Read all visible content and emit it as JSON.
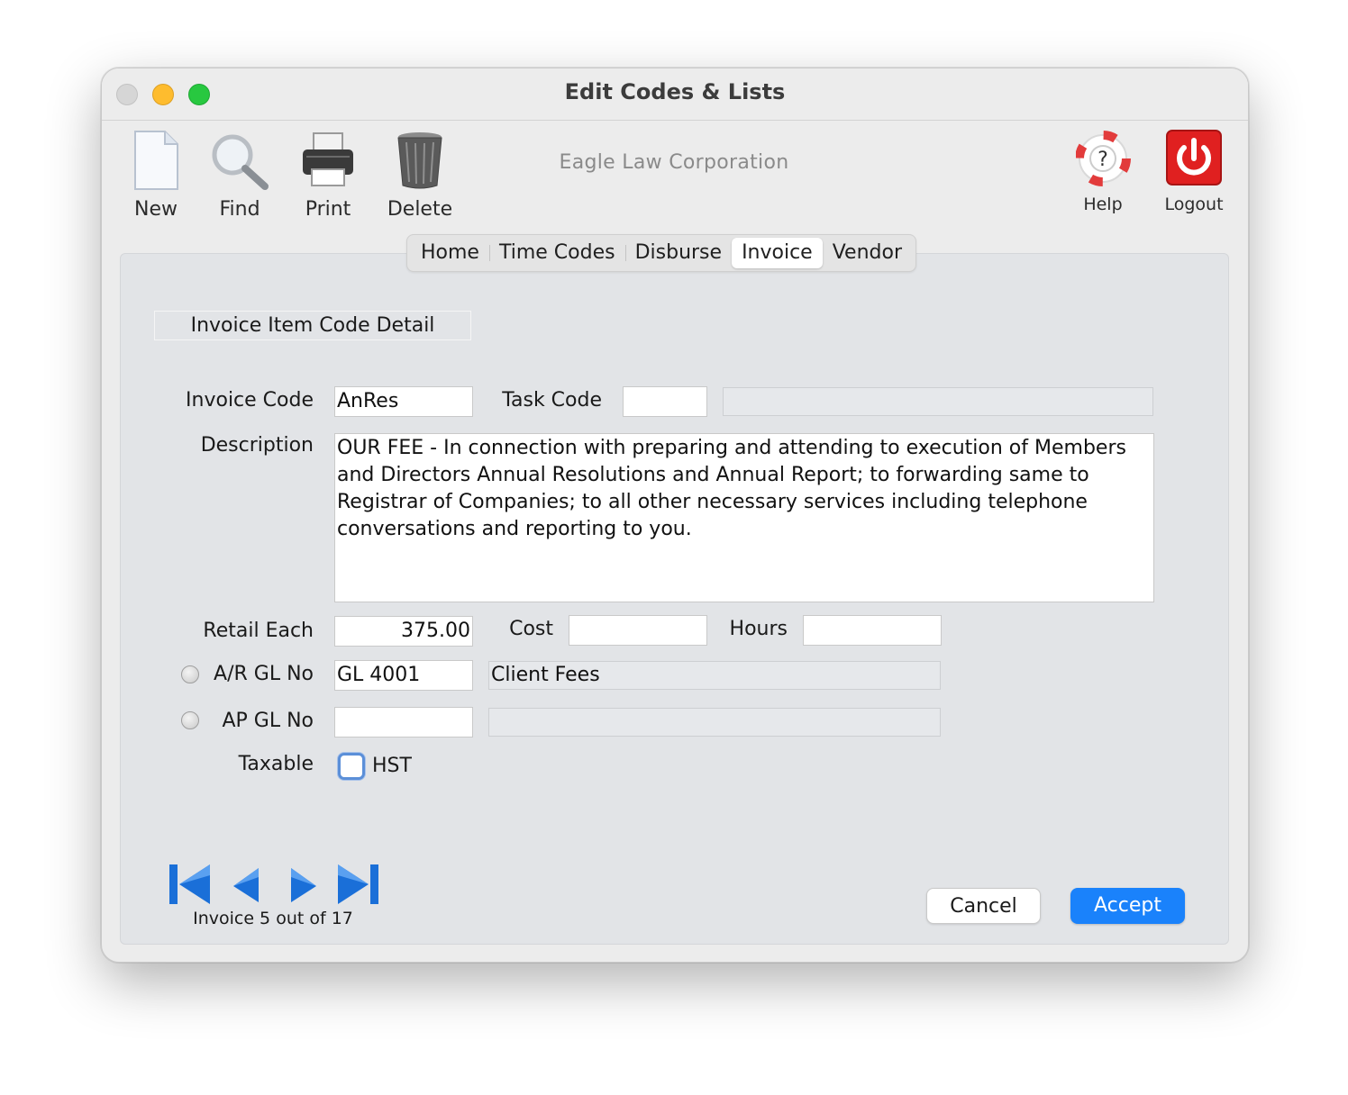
{
  "window": {
    "title": "Edit Codes & Lists"
  },
  "toolbar": {
    "new_label": "New",
    "find_label": "Find",
    "print_label": "Print",
    "delete_label": "Delete",
    "help_label": "Help",
    "logout_label": "Logout",
    "company": "Eagle Law Corporation"
  },
  "tabs": [
    {
      "label": "Home"
    },
    {
      "label": "Time Codes"
    },
    {
      "label": "Disburse"
    },
    {
      "label": "Invoice",
      "active": true
    },
    {
      "label": "Vendor"
    }
  ],
  "section_title": "Invoice Item Code Detail",
  "form": {
    "invoice_code_label": "Invoice Code",
    "invoice_code": "AnRes",
    "task_code_label": "Task Code",
    "task_code": "",
    "task_desc": "",
    "description_label": "Description",
    "description": "OUR FEE - In connection with preparing and attending to execution of Members and Directors Annual Resolutions and Annual Report; to forwarding same to Registrar of Companies; to all other necessary services including telephone conversations and reporting to you.",
    "retail_each_label": "Retail Each",
    "retail_each": "375.00",
    "cost_label": "Cost",
    "cost": "",
    "hours_label": "Hours",
    "hours": "",
    "ar_gl_label": "A/R GL No",
    "ar_gl": "GL 4001",
    "ar_gl_desc": "Client Fees",
    "ap_gl_label": "AP GL No",
    "ap_gl": "",
    "ap_gl_desc": "",
    "taxable_label": "Taxable",
    "hst_label": "HST",
    "hst_checked": false
  },
  "navigation": {
    "counter": "Invoice 5 out of 17"
  },
  "buttons": {
    "cancel": "Cancel",
    "accept": "Accept"
  },
  "colors": {
    "accent": "#1a82fb",
    "logout": "#e02020",
    "nav_arrows": "#1a6fd8"
  }
}
